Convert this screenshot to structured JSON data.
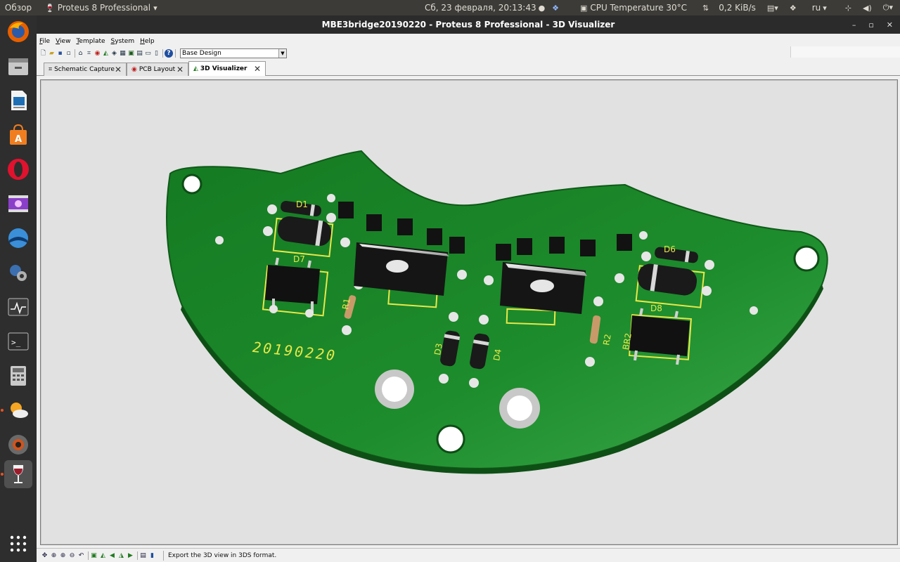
{
  "top_bar": {
    "overview": "Обзор",
    "app_menu": "Proteus 8 Professional",
    "clock": "Сб, 23 февраля, 20:13:43",
    "cpu": "CPU Temperature 30°C",
    "net": "0,2 KiB/s",
    "lang": "ru"
  },
  "window": {
    "title": "MBE3bridge20190220 - Proteus 8 Professional - 3D Visualizer"
  },
  "menu": [
    "File",
    "View",
    "Template",
    "System",
    "Help"
  ],
  "toolbar": {
    "design_select": "Base Design"
  },
  "tabs": [
    {
      "label": "Schematic Capture"
    },
    {
      "label": "PCB Layout"
    },
    {
      "label": "3D Visualizer"
    }
  ],
  "pcb": {
    "date_text": "20190220",
    "labels": {
      "d1": "D1",
      "d7": "D7",
      "r1": "R1",
      "d3": "D3",
      "d4": "D4",
      "r2": "R2",
      "br2": "BR2",
      "d8": "D8",
      "d6": "D6"
    },
    "colors": {
      "board": "#1f8a2e",
      "silk": "#e8e84a",
      "pad": "#e6e6e6"
    }
  },
  "status": {
    "message": "Export the 3D view in 3DS format."
  }
}
